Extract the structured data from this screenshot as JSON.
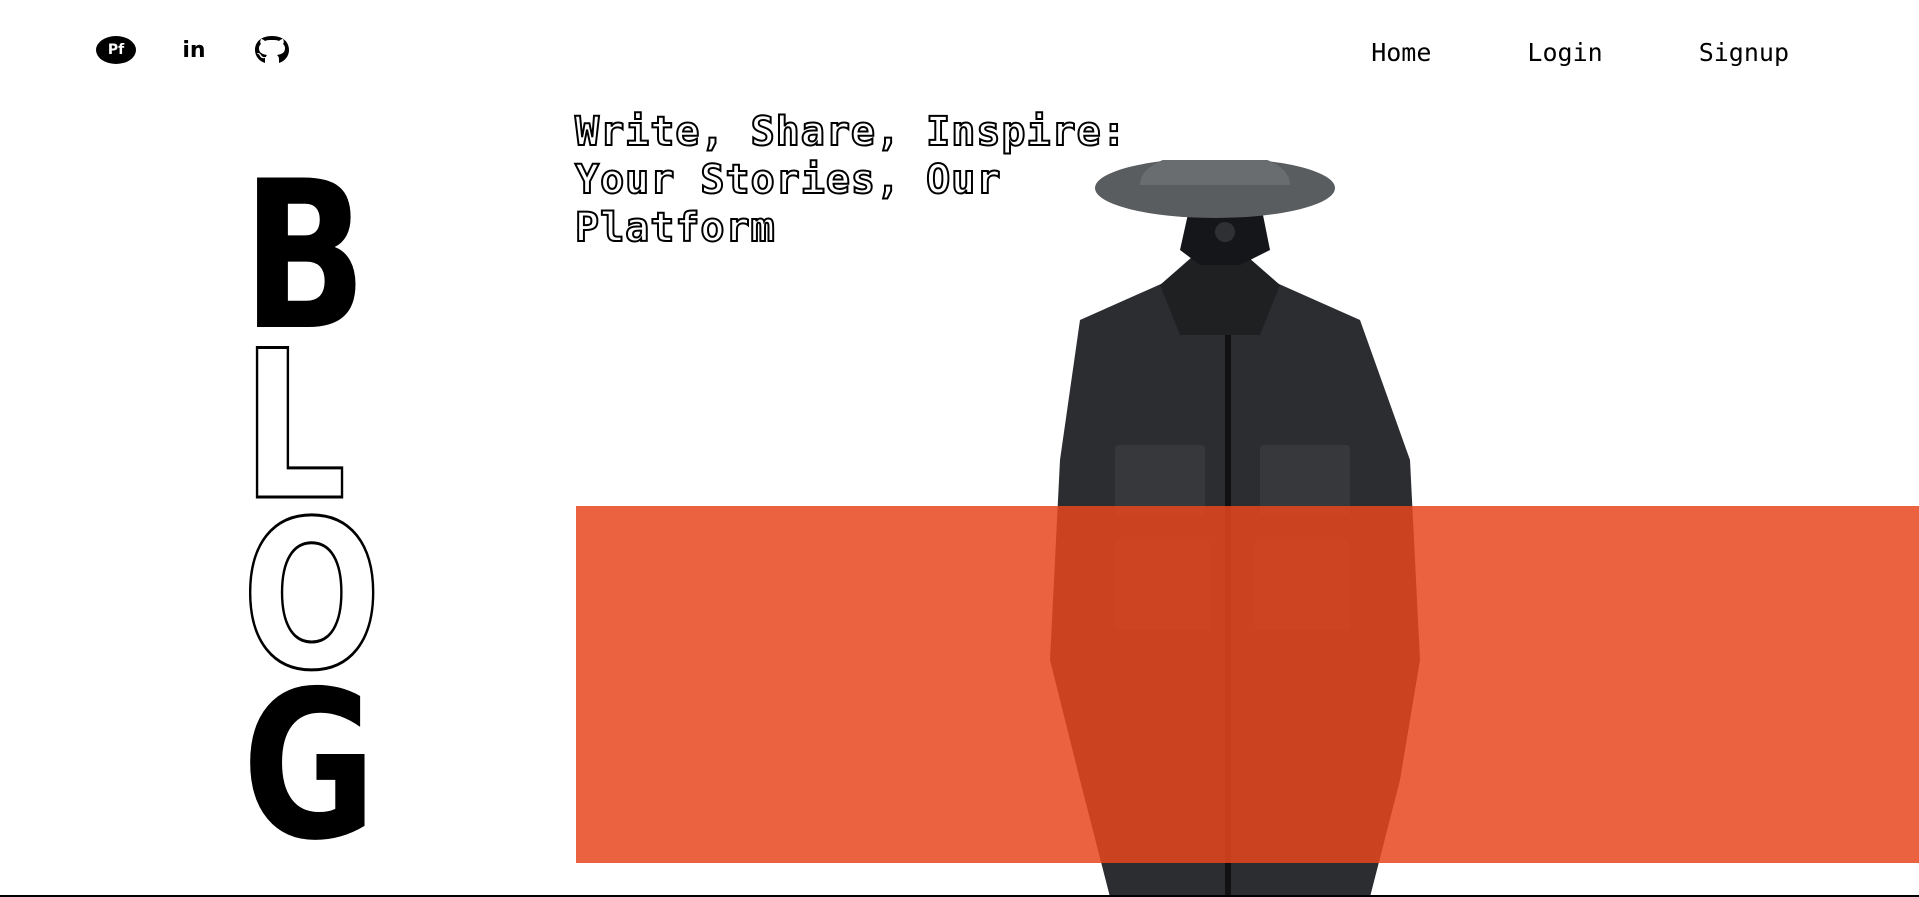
{
  "social": [
    {
      "name": "portfolio",
      "label": "Pf"
    },
    {
      "name": "linkedin",
      "label": "in"
    },
    {
      "name": "github",
      "label": ""
    }
  ],
  "nav": {
    "home": "Home",
    "login": "Login",
    "signup": "Signup"
  },
  "hero": {
    "tagline_line1": "Write, Share, Inspire:",
    "tagline_line2": "Your Stories, Our",
    "tagline_line3": "Platform",
    "blog_letters": [
      "B",
      "L",
      "O",
      "G"
    ]
  },
  "colors": {
    "accent": "#e8461f",
    "text": "#000000",
    "background": "#ffffff",
    "jacket": "#2b2d30",
    "hat": "#5a5d60"
  }
}
